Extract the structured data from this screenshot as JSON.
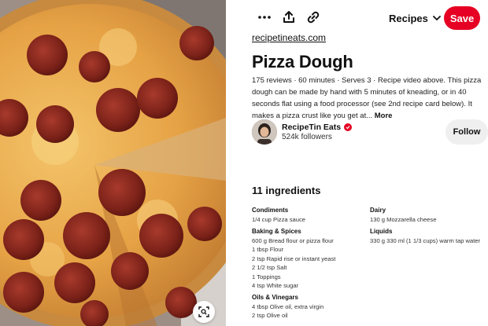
{
  "toolbar": {
    "more_icon": "ellipsis-icon",
    "share_icon": "share-icon",
    "link_icon": "link-icon",
    "board_label": "Recipes",
    "save_label": "Save"
  },
  "pin": {
    "source": "recipetineats.com",
    "title": "Pizza Dough",
    "description": "175 reviews · 60 minutes · Serves 3 · Recipe video above. This pizza dough can be made by hand with 5 minutes of kneading, or in 40 seconds flat using a food processor (see 2nd recipe card below). It makes a pizza crust like you get at...",
    "more_label": "More"
  },
  "creator": {
    "name": "RecipeTin Eats",
    "followers": "524k followers",
    "follow_label": "Follow"
  },
  "ingredients": {
    "heading": "11 ingredients",
    "col1": [
      {
        "title": "Condiments",
        "items": [
          "1/4 cup Pizza sauce"
        ]
      },
      {
        "title": "Baking & Spices",
        "items": [
          "600 g Bread flour or pizza flour",
          "1 tbsp Flour",
          "2 tsp Rapid rise or instant yeast",
          "2 1/2 tsp Salt",
          "1 Toppings",
          "4 tsp White sugar"
        ]
      },
      {
        "title": "Oils & Vinegars",
        "items": [
          "4 tbsp Olive oil, extra virgin",
          "2 tsp Olive oil"
        ]
      }
    ],
    "col2": [
      {
        "title": "Dairy",
        "items": [
          "130 g Mozzarella cheese"
        ]
      },
      {
        "title": "Liquids",
        "items": [
          "330 g 330 ml (1 1/3 cups) warm tap water"
        ]
      }
    ]
  },
  "colors": {
    "save": "#e60023",
    "follow_bg": "#efefef",
    "text": "#111111"
  }
}
